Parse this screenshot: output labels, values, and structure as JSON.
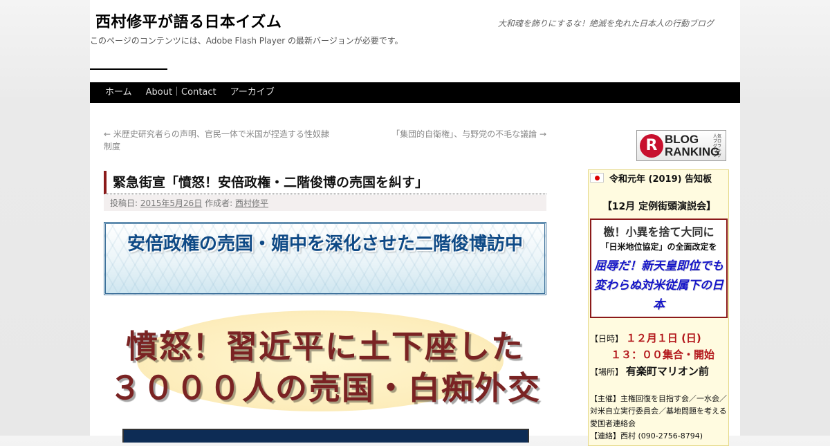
{
  "site": {
    "title": "西村修平が語る日本イズム",
    "description": "大和魂を飾りにするな！絶滅を免れた日本人の行動ブログ",
    "flash_message": "このページのコンテンツには、Adobe Flash Player の最新バージョンが必要です。"
  },
  "nav": {
    "items": [
      "ホーム",
      "About｜Contact",
      "アーカイブ"
    ]
  },
  "post_nav": {
    "prev": "← 米歴史研究者らの声明、官民一体で米国が捏造する性奴隷制度",
    "next": "「集団的自衛権」、与野党の不毛な議論 →"
  },
  "entry": {
    "title": "緊急街宣「憤怒！安倍政権・二階俊博の売国を糾す」",
    "meta_posted_label": "投稿日:",
    "meta_date": "2015年5月26日",
    "meta_author_label": "作成者:",
    "meta_author": "西村修平",
    "banner_text": "安倍政権の売国・媚中を深化させた二階俊博訪中",
    "headline_line1": "憤怒！習近平に土下座した",
    "headline_line2": "３０００人の売国・白痴外交"
  },
  "sidebar": {
    "ranking": {
      "main": "BLOG RANKING",
      "small": "人気ブログランキング"
    },
    "notice": {
      "title": "令和元年 (2019) 告知板",
      "event": "【12月 定例街頭演説会】",
      "slogan1": "檄！小異を捨て大同に",
      "slogan2": "「日米地位協定」の全面改定を",
      "slogan3": "屈辱だ！新天皇即位でも変わらぬ対米従属下の日本",
      "date_label": "【日時】",
      "date_value": "１２月１日 (日)",
      "time_value": "１３：００集合・開始",
      "place_label": "【場所】",
      "place_value": "有楽町マリオン前",
      "organizer": "【主催】主権回復を目指す会／一水会／対米自立実行委員会／基地問題を考える愛国者連絡会",
      "contact": "【連絡】西村 (090-2756-8794)"
    }
  }
}
